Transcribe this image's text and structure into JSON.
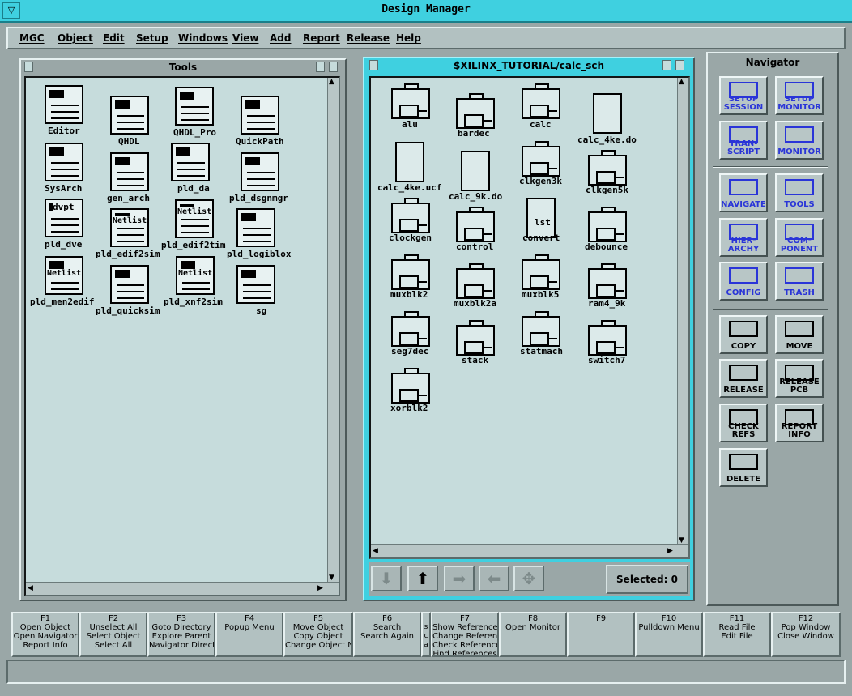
{
  "window": {
    "title": "Design Manager"
  },
  "menu": [
    "MGC",
    "Object",
    "Edit",
    "Setup",
    "Windows",
    "View",
    "Add",
    "Report",
    "Release",
    "Help"
  ],
  "tools_pane": {
    "title": "Tools",
    "items": [
      "Editor",
      "QHDL",
      "QHDL_Pro",
      "QuickPath",
      "SysArch",
      "gen_arch",
      "pld_da",
      "pld_dsgnmgr",
      "pld_dve",
      "pld_edif2sim",
      "pld_edif2tim",
      "pld_logiblox",
      "pld_men2edif",
      "pld_quicksim",
      "pld_xnf2sim",
      "sg"
    ],
    "icon_texts": {
      "dvpt": "dvpt",
      "netlist": "Netlist"
    }
  },
  "dir_pane": {
    "title": "$XILINX_TUTORIAL/calc_sch",
    "items": [
      "alu",
      "bardec",
      "calc",
      "calc_4ke.do",
      "calc_4ke.ucf",
      "calc_9k.do",
      "clkgen3k",
      "clkgen5k",
      "clockgen",
      "control",
      "convert",
      "debounce",
      "muxblk2",
      "muxblk2a",
      "muxblk5",
      "ram4_9k",
      "seg7dec",
      "stack",
      "statmach",
      "switch7",
      "xorblk2"
    ],
    "convert_icon_text": "lst",
    "selected": "Selected: 0"
  },
  "navigator": {
    "title": "Navigator",
    "buttons": [
      "SETUP\nSESSION",
      "SETUP\nMONITOR",
      "TRAN-\nSCRIPT",
      "MONITOR",
      "NAVIGATE",
      "TOOLS",
      "HIER-\nARCHY",
      "COM-\nPONENT",
      "CONFIG",
      "TRASH",
      "COPY",
      "MOVE",
      "RELEASE",
      "RELEASE\nPCB",
      "CHECK\nREFS",
      "REPORT\nINFO",
      "DELETE"
    ]
  },
  "fkeys": [
    {
      "key": "F1",
      "lines": [
        "Open Object",
        "Open Navigator",
        "Report Info"
      ]
    },
    {
      "key": "F2",
      "lines": [
        "Unselect All",
        "Select Object",
        "Select All"
      ]
    },
    {
      "key": "F3",
      "lines": [
        "Goto Directory",
        "Explore Parent",
        "Navigator Director"
      ]
    },
    {
      "key": "F4",
      "lines": [
        "Popup Menu"
      ]
    },
    {
      "key": "F5",
      "lines": [
        "Move Object",
        "Copy Object",
        "Change Object Nam"
      ]
    },
    {
      "key": "F6",
      "lines": [
        "Search",
        "Search Again"
      ]
    },
    {
      "key": "F7",
      "lines": [
        "Show References",
        "Change Reference",
        "Check References",
        "Find References"
      ]
    },
    {
      "key": "F8",
      "lines": [
        "Open Monitor"
      ]
    },
    {
      "key": "F9",
      "lines": []
    },
    {
      "key": "F10",
      "lines": [
        "Pulldown Menu"
      ]
    },
    {
      "key": "F11",
      "lines": [
        "Read File",
        "Edit File"
      ]
    },
    {
      "key": "F12",
      "lines": [
        "Pop Window",
        "Close Window"
      ]
    }
  ],
  "sca_label": [
    "s",
    "c",
    "a"
  ]
}
